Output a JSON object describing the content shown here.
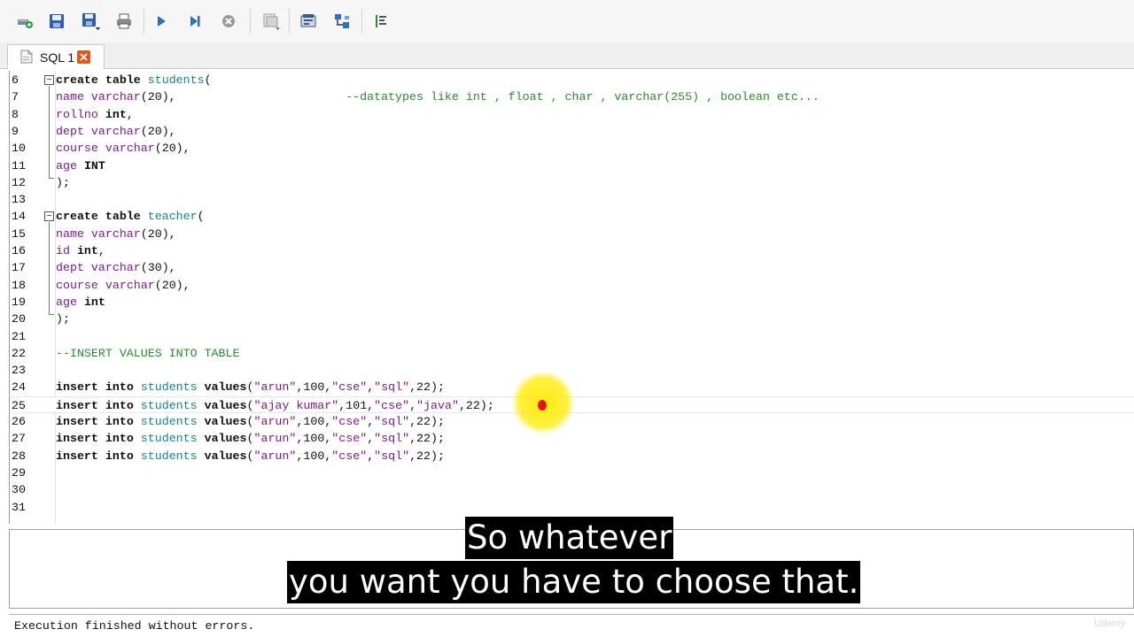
{
  "toolbar": {
    "buttons": [
      {
        "name": "new-connection-icon"
      },
      {
        "name": "save-icon"
      },
      {
        "name": "save-as-icon"
      },
      {
        "name": "print-icon"
      },
      {
        "name": "run-icon"
      },
      {
        "name": "run-selected-icon"
      },
      {
        "name": "stop-icon"
      },
      {
        "name": "export-icon"
      },
      {
        "name": "explain-icon"
      },
      {
        "name": "query-builder-icon"
      },
      {
        "name": "format-icon"
      }
    ]
  },
  "tab": {
    "label": "SQL 1"
  },
  "editor": {
    "current_line": "25",
    "lines": [
      {
        "n": "6"
      },
      {
        "n": "7"
      },
      {
        "n": "8"
      },
      {
        "n": "9"
      },
      {
        "n": "10"
      },
      {
        "n": "11"
      },
      {
        "n": "12"
      },
      {
        "n": "13"
      },
      {
        "n": "14"
      },
      {
        "n": "15"
      },
      {
        "n": "16"
      },
      {
        "n": "17"
      },
      {
        "n": "18"
      },
      {
        "n": "19"
      },
      {
        "n": "20"
      },
      {
        "n": "21"
      },
      {
        "n": "22"
      },
      {
        "n": "23"
      },
      {
        "n": "24"
      },
      {
        "n": "25"
      },
      {
        "n": "26"
      },
      {
        "n": "27"
      },
      {
        "n": "28"
      },
      {
        "n": "29"
      },
      {
        "n": "30"
      },
      {
        "n": "31"
      }
    ],
    "code": {
      "l6": [
        "create",
        "table",
        "students",
        "("
      ],
      "l7": [
        "name",
        "varchar",
        "(20),",
        "--datatypes like int , float , char , varchar(255) , boolean etc..."
      ],
      "l8": [
        "rollno",
        "int",
        ","
      ],
      "l9": [
        "dept",
        "varchar",
        "(20),"
      ],
      "l10": [
        "course",
        "varchar",
        "(20),"
      ],
      "l11": [
        "age",
        "INT"
      ],
      "l12": [
        ");"
      ],
      "l14": [
        "create",
        "table",
        "teacher",
        "("
      ],
      "l15": [
        "name",
        "varchar",
        "(20),"
      ],
      "l16": [
        "id",
        "int",
        ","
      ],
      "l17": [
        "dept",
        "varchar",
        "(30),"
      ],
      "l18": [
        "course",
        "varchar",
        "(20),"
      ],
      "l19": [
        "age",
        "int"
      ],
      "l20": [
        ");"
      ],
      "l22": [
        "--INSERT VALUES INTO TABLE"
      ],
      "l24": [
        "insert",
        "into",
        "students",
        "values",
        "(",
        "\"arun\"",
        ",100,",
        "\"cse\"",
        ",",
        "\"sql\"",
        ",22);"
      ],
      "l25": [
        "insert",
        "into",
        "students",
        "values",
        "(",
        "\"ajay kumar\"",
        ",101,",
        "\"cse\"",
        ",",
        "\"java\"",
        ",22);"
      ],
      "l26": [
        "insert",
        "into",
        "students",
        "values",
        "(",
        "\"arun\"",
        ",100,",
        "\"cse\"",
        ",",
        "\"sql\"",
        ",22);"
      ],
      "l27": [
        "insert",
        "into",
        "students",
        "values",
        "(",
        "\"arun\"",
        ",100,",
        "\"cse\"",
        ",",
        "\"sql\"",
        ",22);"
      ],
      "l28": [
        "insert",
        "into",
        "students",
        "values",
        "(",
        "\"arun\"",
        ",100,",
        "\"cse\"",
        ",",
        "\"sql\"",
        ",22);"
      ]
    }
  },
  "status": {
    "message": "Execution finished without errors."
  },
  "watermark": "Udemy",
  "subtitles": {
    "line1": "So whatever",
    "line2": "you want you have to choose that."
  }
}
